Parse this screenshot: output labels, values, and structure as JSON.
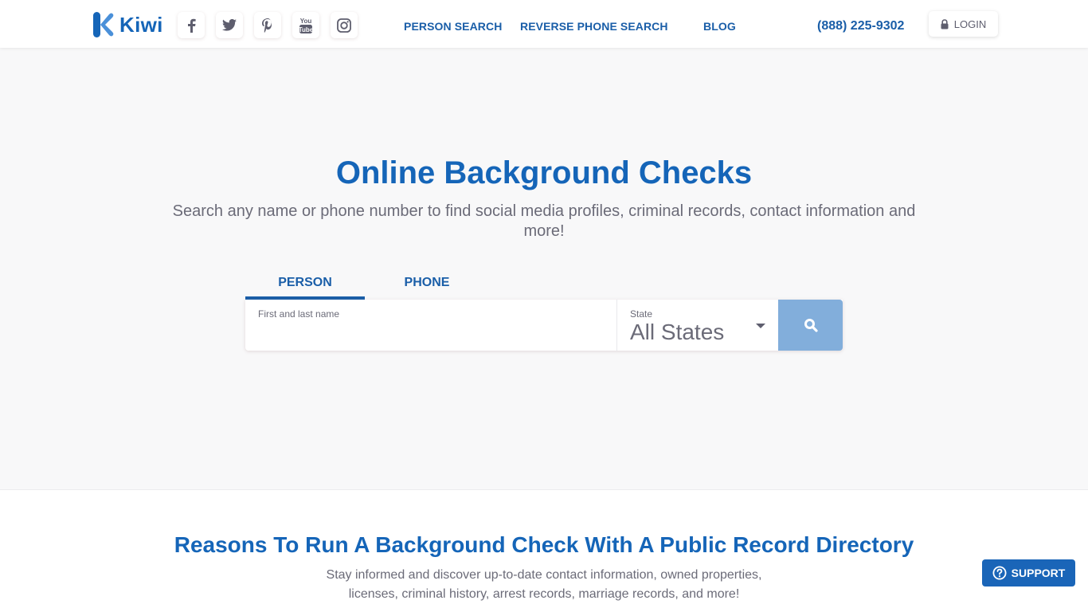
{
  "header": {
    "logo_text": "Kiwi",
    "social_icons": [
      "facebook-icon",
      "twitter-icon",
      "pinterest-icon",
      "youtube-icon",
      "instagram-icon"
    ],
    "nav": [
      {
        "label": "PERSON SEARCH"
      },
      {
        "label": "REVERSE PHONE SEARCH"
      },
      {
        "label": "BLOG"
      }
    ],
    "phone": "(888) 225-9302",
    "login_label": "LOGIN"
  },
  "hero": {
    "title": "Online Background Checks",
    "subtitle": "Search any name or phone number to find social media profiles, criminal records, contact information and more!"
  },
  "search": {
    "tabs": [
      {
        "label": "PERSON",
        "active": true
      },
      {
        "label": "PHONE",
        "active": false
      }
    ],
    "name_label": "First and last name",
    "name_value": "",
    "state_label": "State",
    "state_value": "All States"
  },
  "section": {
    "title": "Reasons To Run A Background Check With A Public Record Directory",
    "subtitle_line1": "Stay informed and discover up-to-date contact information, owned properties,",
    "subtitle_line2": "licenses, criminal history, arrest records, marriage records, and more!"
  },
  "support": {
    "label": "SUPPORT"
  },
  "colors": {
    "brand": "#1565b8",
    "search_button": "#82aedb",
    "text_muted": "#6b6b78",
    "hero_bg": "#f8f8f9"
  }
}
